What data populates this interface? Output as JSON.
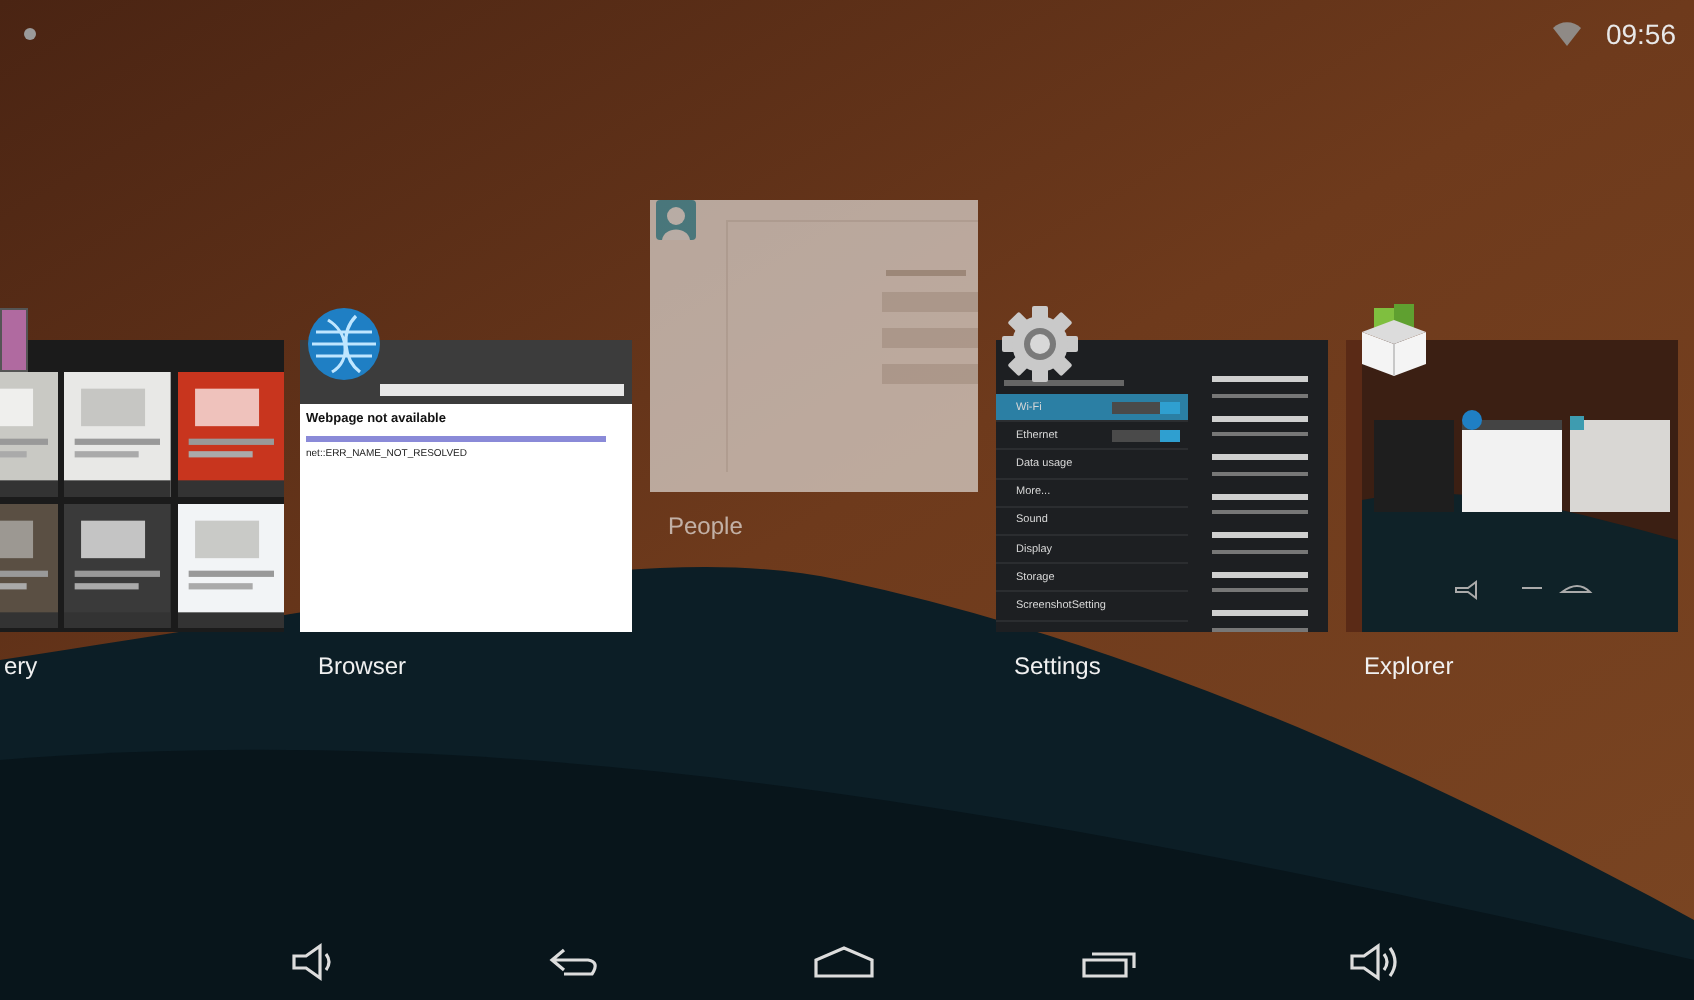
{
  "status_bar": {
    "time": "09:56"
  },
  "recent_apps": [
    {
      "kind": "gallery",
      "label": "ery",
      "raised": false
    },
    {
      "kind": "browser",
      "label": "Browser",
      "raised": false,
      "page_title": "Webpage not available",
      "error": "net::ERR_NAME_NOT_RESOLVED"
    },
    {
      "kind": "people",
      "label": "People",
      "raised": true
    },
    {
      "kind": "settings",
      "label": "Settings",
      "raised": false,
      "items": [
        {
          "label": "Wi-Fi",
          "selected": true,
          "toggle": true
        },
        {
          "label": "Ethernet",
          "selected": false,
          "toggle": true
        },
        {
          "label": "Data usage",
          "selected": false,
          "toggle": false
        },
        {
          "label": "More...",
          "selected": false,
          "toggle": false
        },
        {
          "label": "Sound",
          "selected": false,
          "toggle": false
        },
        {
          "label": "Display",
          "selected": false,
          "toggle": false
        },
        {
          "label": "Storage",
          "selected": false,
          "toggle": false
        },
        {
          "label": "ScreenshotSetting",
          "selected": false,
          "toggle": false
        }
      ]
    },
    {
      "kind": "explorer",
      "label": "Explorer",
      "raised": false
    }
  ]
}
